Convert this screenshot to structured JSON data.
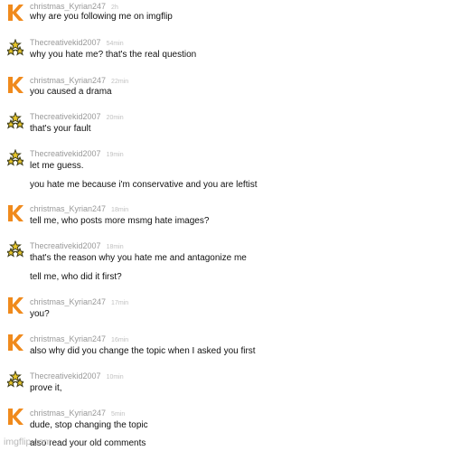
{
  "comments": [
    {
      "user": "christmas_Kyrian247",
      "time": "2h",
      "avatar": "k-orange-avatar-icon",
      "lines": [
        "why are you following me on imgflip"
      ]
    },
    {
      "user": "Thecreativekid2007",
      "time": "54min",
      "avatar": "stars-triangle-avatar-icon",
      "lines": [
        "why you hate me? that's the real question"
      ]
    },
    {
      "user": "christmas_Kyrian247",
      "time": "22min",
      "avatar": "k-orange-avatar-icon",
      "lines": [
        "you caused a drama"
      ]
    },
    {
      "user": "Thecreativekid2007",
      "time": "20min",
      "avatar": "stars-triangle-avatar-icon",
      "lines": [
        "that's your fault"
      ]
    },
    {
      "user": "Thecreativekid2007",
      "time": "19min",
      "avatar": "stars-triangle-avatar-icon",
      "lines": [
        "let me guess.",
        "you hate me because i'm conservative and you are leftist"
      ]
    },
    {
      "user": "christmas_Kyrian247",
      "time": "18min",
      "avatar": "k-orange-avatar-icon",
      "lines": [
        "tell me, who posts more msmg hate images?"
      ]
    },
    {
      "user": "Thecreativekid2007",
      "time": "18min",
      "avatar": "stars-triangle-avatar-icon",
      "lines": [
        "that's the reason why you hate me and antagonize me",
        "tell me, who did it first?"
      ]
    },
    {
      "user": "christmas_Kyrian247",
      "time": "17min",
      "avatar": "k-orange-avatar-icon",
      "lines": [
        "you?"
      ]
    },
    {
      "user": "christmas_Kyrian247",
      "time": "16min",
      "avatar": "k-orange-avatar-icon",
      "lines": [
        "also why did you change the topic when I asked you first"
      ]
    },
    {
      "user": "Thecreativekid2007",
      "time": "10min",
      "avatar": "stars-triangle-avatar-icon",
      "lines": [
        "prove it,"
      ]
    },
    {
      "user": "christmas_Kyrian247",
      "time": "5min",
      "avatar": "k-orange-avatar-icon",
      "lines": [
        "dude, stop changing the topic",
        "also read your old comments"
      ]
    }
  ],
  "watermark": "imgflip.com",
  "colors": {
    "k_orange": "#f08a1c",
    "star_dark": "#3a3a1a",
    "star_gold": "#e8c62a"
  }
}
